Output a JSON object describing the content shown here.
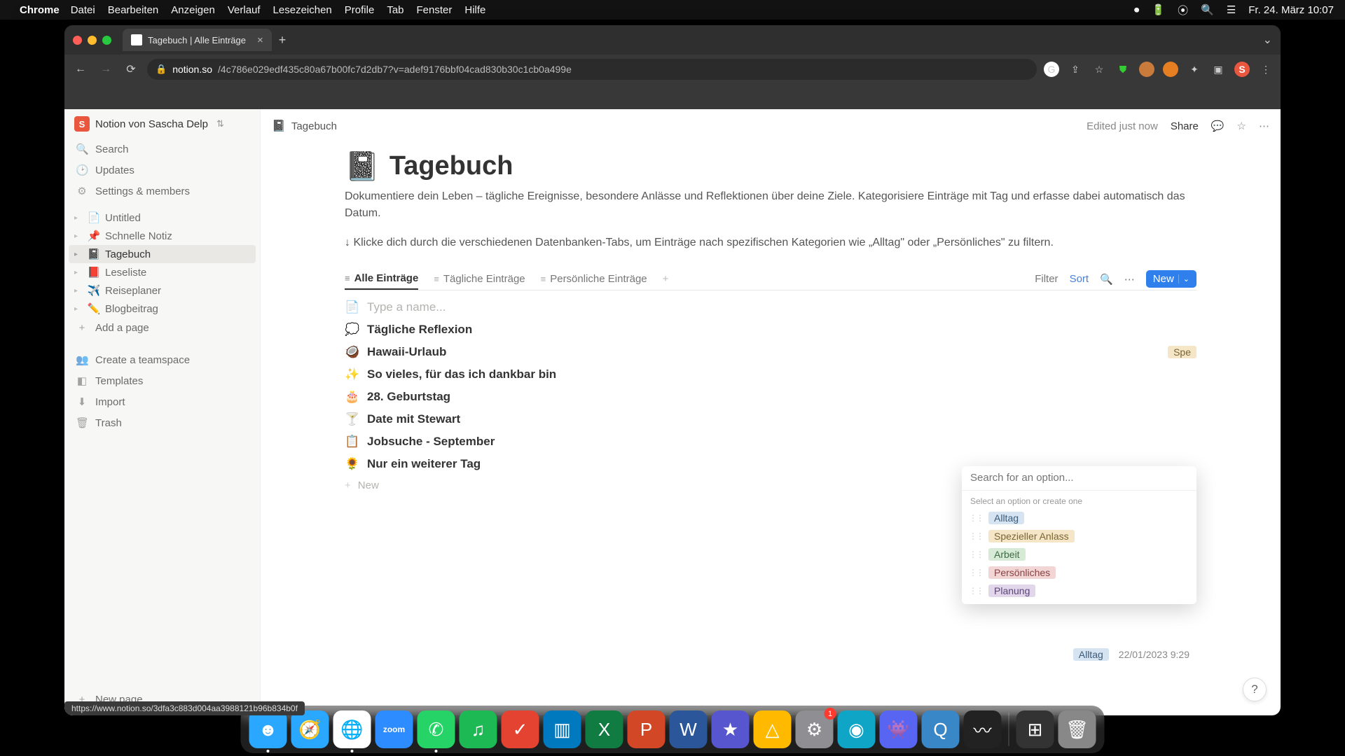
{
  "menubar": {
    "app": "Chrome",
    "items": [
      "Datei",
      "Bearbeiten",
      "Anzeigen",
      "Verlauf",
      "Lesezeichen",
      "Profile",
      "Tab",
      "Fenster",
      "Hilfe"
    ],
    "datetime": "Fr. 24. März  10:07"
  },
  "browser": {
    "tab_title": "Tagebuch | Alle Einträge",
    "url_domain": "notion.so",
    "url_path": "/4c786e029edf435c80a67b00fc7d2db7?v=adef9176bbf04cad830b30c1cb0a499e"
  },
  "workspace": {
    "name": "Notion von Sascha Delp",
    "initial": "S"
  },
  "sidebar": {
    "search": "Search",
    "updates": "Updates",
    "settings": "Settings & members",
    "pages": [
      {
        "emoji": "📄",
        "label": "Untitled"
      },
      {
        "emoji": "📌",
        "label": "Schnelle Notiz"
      },
      {
        "emoji": "📓",
        "label": "Tagebuch",
        "active": true
      },
      {
        "emoji": "📕",
        "label": "Leseliste"
      },
      {
        "emoji": "✈️",
        "label": "Reiseplaner"
      },
      {
        "emoji": "✏️",
        "label": "Blogbeitrag"
      }
    ],
    "add_page": "Add a page",
    "teamspace": "Create a teamspace",
    "templates": "Templates",
    "import": "Import",
    "trash": "Trash",
    "new_page": "New page"
  },
  "topbar": {
    "breadcrumb_emoji": "📓",
    "breadcrumb": "Tagebuch",
    "edited": "Edited just now",
    "share": "Share"
  },
  "page": {
    "emoji": "📓",
    "title": "Tagebuch",
    "desc1": "Dokumentiere dein Leben – tägliche Ereignisse, besondere Anlässe und Reflektionen über deine Ziele. Kategorisiere Einträge mit Tag und erfasse dabei automatisch das Datum.",
    "desc2": "↓ Klicke dich durch die verschiedenen Datenbanken-Tabs, um Einträge nach spezifischen Kategorien wie „Alltag\" oder „Persönliches\" zu filtern."
  },
  "db": {
    "tabs": [
      {
        "icon": "≡",
        "label": "Alle Einträge",
        "active": true
      },
      {
        "icon": "≡",
        "label": "Tägliche Einträge"
      },
      {
        "icon": "≡",
        "label": "Persönliche Einträge"
      }
    ],
    "filter": "Filter",
    "sort": "Sort",
    "new": "New"
  },
  "entries": [
    {
      "emoji": "📄",
      "title": "Type a name...",
      "placeholder": true
    },
    {
      "emoji": "💭",
      "title": "Tägliche Reflexion"
    },
    {
      "emoji": "🥥",
      "title": "Hawaii-Urlaub",
      "tag": "Spe",
      "tag_class": "tag-yellow"
    },
    {
      "emoji": "✨",
      "title": "So vieles, für das ich dankbar bin"
    },
    {
      "emoji": "🎂",
      "title": "28. Geburtstag"
    },
    {
      "emoji": "🍸",
      "title": "Date mit Stewart"
    },
    {
      "emoji": "📋",
      "title": "Jobsuche - September"
    },
    {
      "emoji": "🌻",
      "title": "Nur ein weiterer Tag"
    }
  ],
  "new_row": "New",
  "row_below": {
    "tag": "Alltag",
    "tag_class": "tag-blue",
    "date": "22/01/2023 9:29"
  },
  "popup": {
    "search_placeholder": "Search for an option...",
    "label": "Select an option or create one",
    "options": [
      {
        "label": "Alltag",
        "class": "tag-blue"
      },
      {
        "label": "Spezieller Anlass",
        "class": "tag-yellow"
      },
      {
        "label": "Arbeit",
        "class": "tag-green"
      },
      {
        "label": "Persönliches",
        "class": "tag-red"
      },
      {
        "label": "Planung",
        "class": "tag-purple"
      }
    ]
  },
  "status_url": "https://www.notion.so/3dfa3c883d004aa3988121b96b834b0f",
  "dock": {
    "apps": [
      {
        "name": "finder",
        "color": "#2aa7ff",
        "glyph": "☻",
        "running": true
      },
      {
        "name": "safari",
        "color": "#2aa7ff",
        "glyph": "🧭"
      },
      {
        "name": "chrome",
        "color": "#fff",
        "glyph": "🌐",
        "running": true
      },
      {
        "name": "zoom",
        "color": "#2d8cff",
        "glyph": "zoom",
        "text": true
      },
      {
        "name": "whatsapp",
        "color": "#25d366",
        "glyph": "✆",
        "running": true
      },
      {
        "name": "spotify",
        "color": "#1db954",
        "glyph": "♫"
      },
      {
        "name": "todoist",
        "color": "#e44332",
        "glyph": "✓"
      },
      {
        "name": "trello",
        "color": "#0079bf",
        "glyph": "▥"
      },
      {
        "name": "excel",
        "color": "#107c41",
        "glyph": "X"
      },
      {
        "name": "powerpoint",
        "color": "#d24726",
        "glyph": "P"
      },
      {
        "name": "word",
        "color": "#2b579a",
        "glyph": "W"
      },
      {
        "name": "imovie",
        "color": "#5856cf",
        "glyph": "★"
      },
      {
        "name": "drive",
        "color": "#ffba00",
        "glyph": "△"
      },
      {
        "name": "settings",
        "color": "#8e8e93",
        "glyph": "⚙",
        "badge": "1"
      },
      {
        "name": "siri",
        "color": "#0ea5c6",
        "glyph": "◉"
      },
      {
        "name": "discord",
        "color": "#5865f2",
        "glyph": "👾"
      },
      {
        "name": "quicktime",
        "color": "#3a87c7",
        "glyph": "Q"
      },
      {
        "name": "voice",
        "color": "#222",
        "glyph": "〰"
      }
    ],
    "right": [
      {
        "name": "mission",
        "color": "#333",
        "glyph": "⊞"
      },
      {
        "name": "trash",
        "color": "#888",
        "glyph": "🗑"
      }
    ]
  }
}
